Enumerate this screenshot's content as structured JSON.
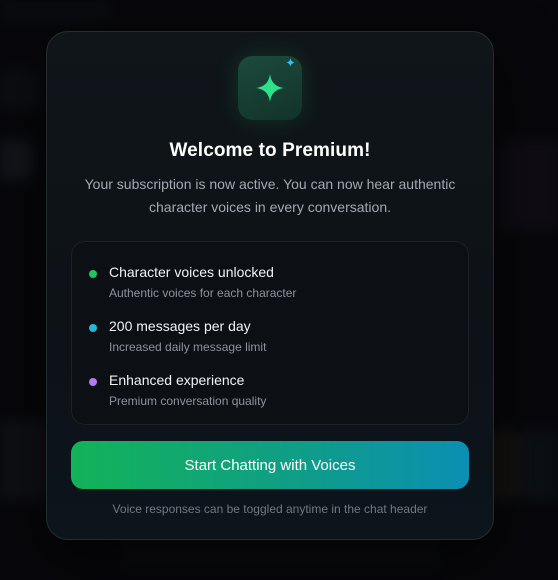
{
  "modal": {
    "title": "Welcome to Premium!",
    "subtitle": "Your subscription is now active. You can now hear authentic character voices in every conversation.",
    "features": [
      {
        "title": "Character voices unlocked",
        "description": "Authentic voices for each character",
        "dot_color": "#22c55e"
      },
      {
        "title": "200 messages per day",
        "description": "Increased daily message limit",
        "dot_color": "#22b8d6"
      },
      {
        "title": "Enhanced experience",
        "description": "Premium conversation quality",
        "dot_color": "#b07cf0"
      }
    ],
    "cta_label": "Start Chatting with Voices",
    "footnote": "Voice responses can be toggled anytime in the chat header",
    "badge_icon": "sparkle-icon"
  },
  "colors": {
    "accent_green": "#22c55e",
    "accent_cyan": "#0c8fb3"
  }
}
